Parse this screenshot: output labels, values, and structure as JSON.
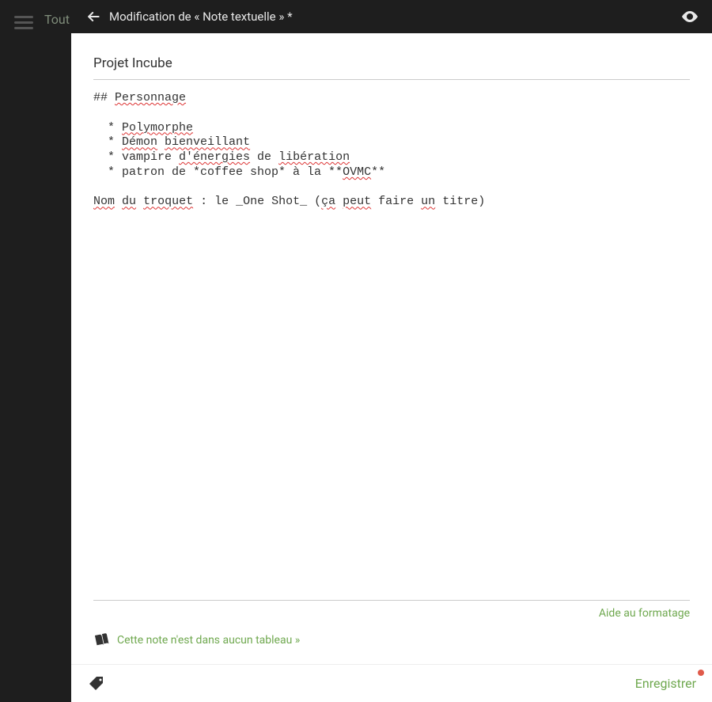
{
  "sidebar": {
    "visible_label": "Tout"
  },
  "topbar": {
    "title": "Modification de « Note textuelle » *"
  },
  "note": {
    "title": "Projet Incube",
    "body_raw": "## Personnage\n\n  * Polymorphe\n  * Démon bienveillant\n  * vampire d'énergies de libération\n  * patron de *coffee shop* à la **OVMC**\n\nNom du troquet : le _One Shot_ (ça peut faire un titre)",
    "body_lines": [
      {
        "parts": [
          {
            "t": "## "
          },
          {
            "t": "Personnage",
            "spell": true
          }
        ]
      },
      {
        "parts": []
      },
      {
        "parts": [
          {
            "t": "  * "
          },
          {
            "t": "Polymorphe",
            "spell": true
          }
        ]
      },
      {
        "parts": [
          {
            "t": "  * "
          },
          {
            "t": "Démon",
            "spell": true
          },
          {
            "t": " "
          },
          {
            "t": "bienveillant",
            "spell": true
          }
        ]
      },
      {
        "parts": [
          {
            "t": "  * vampire "
          },
          {
            "t": "d'énergies",
            "spell": true
          },
          {
            "t": " de "
          },
          {
            "t": "libération",
            "spell": true
          }
        ]
      },
      {
        "parts": [
          {
            "t": "  * patron de *coffee shop* à la **"
          },
          {
            "t": "OVMC",
            "spell": true
          },
          {
            "t": "**"
          }
        ]
      },
      {
        "parts": []
      },
      {
        "parts": [
          {
            "t": "Nom",
            "spell": true
          },
          {
            "t": " "
          },
          {
            "t": "du",
            "spell": true
          },
          {
            "t": " "
          },
          {
            "t": "troquet",
            "spell": true
          },
          {
            "t": " : le _One Shot_ ("
          },
          {
            "t": "ça",
            "spell": true
          },
          {
            "t": " "
          },
          {
            "t": "peut",
            "spell": true
          },
          {
            "t": " faire "
          },
          {
            "t": "un",
            "spell": true
          },
          {
            "t": " titre)"
          }
        ]
      }
    ]
  },
  "help_link": "Aide au formatage",
  "board_link": "Cette note n'est dans aucun tableau »",
  "footer": {
    "save_label": "Enregistrer",
    "dirty": true
  },
  "colors": {
    "accent": "#6fa84f",
    "topbar_bg": "#1e1e1e"
  }
}
